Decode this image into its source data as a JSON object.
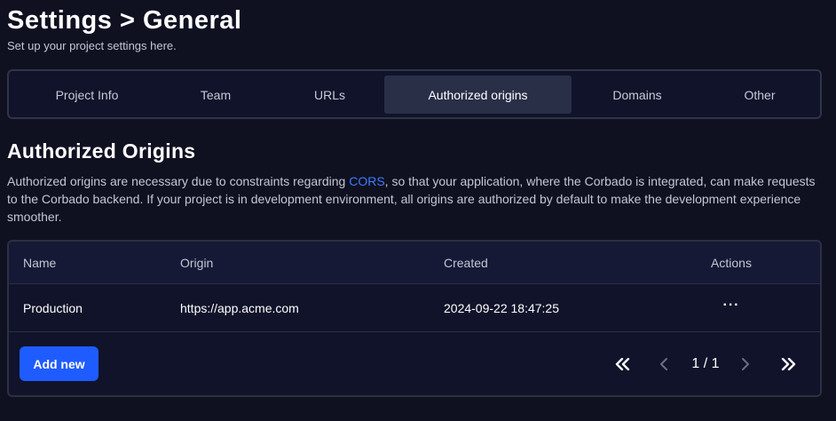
{
  "header": {
    "title": "Settings > General",
    "subtitle": "Set up your project settings here."
  },
  "tabs": [
    {
      "label": "Project Info",
      "active": false
    },
    {
      "label": "Team",
      "active": false
    },
    {
      "label": "URLs",
      "active": false
    },
    {
      "label": "Authorized origins",
      "active": true
    },
    {
      "label": "Domains",
      "active": false
    },
    {
      "label": "Other",
      "active": false
    }
  ],
  "section": {
    "title": "Authorized Origins",
    "description_before": "Authorized origins are necessary due to constraints regarding ",
    "description_link": "CORS",
    "description_after": ", so that your application, where the Corbado is integrated, can make requests to the Corbado backend. If your project is in development environment, all origins are authorized by default to make the development experience smoother."
  },
  "table": {
    "columns": {
      "name": "Name",
      "origin": "Origin",
      "created": "Created",
      "actions": "Actions"
    },
    "rows": [
      {
        "name": "Production",
        "origin": "https://app.acme.com",
        "created": "2024-09-22 18:47:25",
        "actions": "···"
      }
    ]
  },
  "footer": {
    "add_label": "Add new",
    "page_indicator": "1 / 1",
    "current_page": 1,
    "total_pages": 1
  },
  "icons": {
    "first_page": "double-chevron-left-icon",
    "prev_page": "chevron-left-icon",
    "next_page": "chevron-right-icon",
    "last_page": "double-chevron-right-icon",
    "row_actions": "more-horizontal-icon"
  },
  "colors": {
    "background": "#0f1121",
    "accent": "#1f5cff",
    "link": "#3e7bff",
    "border": "#2c3042"
  }
}
